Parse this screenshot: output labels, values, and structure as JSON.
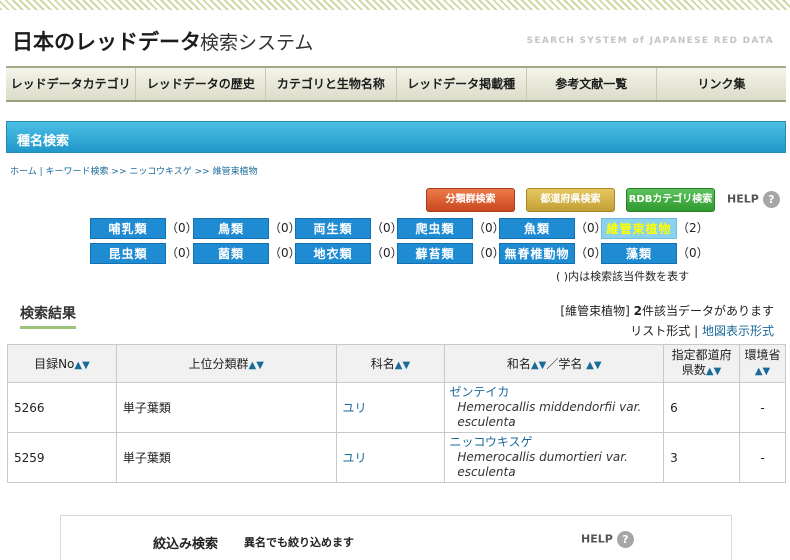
{
  "header": {
    "title": "日本のレッドデータ",
    "subtitle": "検索システム",
    "english": "SEARCH SYSTEM of JAPANESE RED DATA"
  },
  "nav": [
    {
      "label": "レッドデータカテゴリ"
    },
    {
      "label": "レッドデータの歴史"
    },
    {
      "label": "カテゴリと生物名称"
    },
    {
      "label": "レッドデータ掲載種"
    },
    {
      "label": "参考文献一覧"
    },
    {
      "label": "リンク集"
    }
  ],
  "section": {
    "title": "種名検索"
  },
  "breadcrumb": {
    "home": "ホーム",
    "sep1": "|",
    "keyword": "キーワード検索",
    "sep2": ">>",
    "species": "ニッコウキスゲ",
    "sep3": ">>",
    "current": "維管束植物"
  },
  "buttons": {
    "taxon": "分類群検索",
    "prefecture": "都道府県検索",
    "rdb": "RDBカテゴリ検索",
    "help": "HELP",
    "help_icon": "?"
  },
  "categories": [
    {
      "label": "哺乳類",
      "count": "（0）"
    },
    {
      "label": "鳥類",
      "count": "（0）"
    },
    {
      "label": "両生類",
      "count": "（0）"
    },
    {
      "label": "爬虫類",
      "count": "（0）"
    },
    {
      "label": "魚類",
      "count": "（0）"
    },
    {
      "label": "維管束植物",
      "count": "（2）"
    },
    {
      "label": "昆虫類",
      "count": "（0）"
    },
    {
      "label": "菌類",
      "count": "（0）"
    },
    {
      "label": "地衣類",
      "count": "（0）"
    },
    {
      "label": "蘚苔類",
      "count": "（0）"
    },
    {
      "label": "無脊椎動物",
      "count": "（0）"
    },
    {
      "label": "藻類",
      "count": "（0）"
    }
  ],
  "categories_note": "( )内は検索該当件数を表す",
  "results": {
    "title": "検索結果",
    "summary_category": "[維管束植物]",
    "summary_count": "2",
    "summary_text": "件該当データがあります",
    "view_list": "リスト形式",
    "view_sep": "|",
    "view_map": "地図表示形式",
    "sort_arrows": "▲▼",
    "columns": {
      "no": "目録No",
      "upper": "上位分類群",
      "family": "科名",
      "name": "和名",
      "name_sep": "／学名",
      "pref_line1": "指定都道府",
      "pref_line2": "県数",
      "env_line1": "環境省"
    },
    "rows": [
      {
        "no": "5266",
        "upper": "単子葉類",
        "family": "ユリ",
        "jp": "ゼンテイカ",
        "sci": "Hemerocallis middendorfii var. esculenta",
        "pref": "6",
        "env": "-"
      },
      {
        "no": "5259",
        "upper": "単子葉類",
        "family": "ユリ",
        "jp": "ニッコウキスゲ",
        "sci": "Hemerocallis dumortieri var. esculenta",
        "pref": "3",
        "env": "-"
      }
    ]
  },
  "filter": {
    "title": "絞込み検索",
    "subtitle": "異名でも絞り込めます",
    "help": "HELP",
    "help_icon": "?"
  }
}
